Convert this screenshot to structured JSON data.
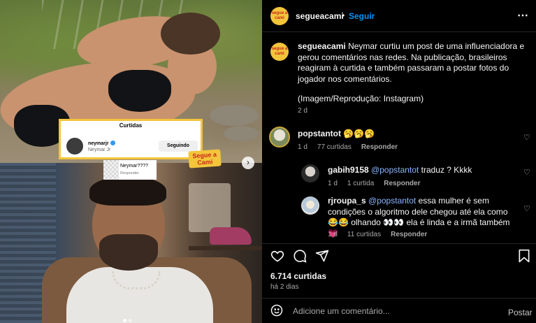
{
  "media": {
    "overlay_title": "Curtidas",
    "overlay_username": "neymarjr",
    "overlay_fullname": "Neymar Jr",
    "overlay_follow": "Seguindo",
    "reply_text": "Neymar????",
    "reply_sub": "Responder",
    "sticker": "Segue a Cami",
    "next_icon": "›"
  },
  "header": {
    "avatar_text": "segue a cami",
    "username": "segueacami",
    "dot": "•",
    "follow": "Seguir",
    "more_icon": "⋯"
  },
  "caption": {
    "avatar_text": "segue a cami",
    "username": "segueacami",
    "text": "Neymar curtiu um post de uma influenciadora e gerou comentários nas redes. Na publicação, brasileiros reagiram à curtida e também passaram a postar fotos do jogador nos comentários.",
    "credit": "(Imagem/Reprodução: Instagram)",
    "time": "2 d"
  },
  "comments": [
    {
      "username": "popstantot",
      "mention": "",
      "text": "🥱🥱🥱",
      "time": "1 d",
      "likes": "77 curtidas",
      "reply": "Responder"
    },
    {
      "username": "gabih9158",
      "mention": "@popstantot",
      "text": " traduz ? Kkkk",
      "time": "1 d",
      "likes": "1 curtida",
      "reply": "Responder"
    },
    {
      "username": "rjroupa_s",
      "mention": "@popstantot",
      "text": " essa mulher é sem condições o algoritmo dele chegou até ela como 😂😂 olhando 👀👀 ela é linda e a irmã também 💗",
      "time": "1 d",
      "likes": "11 curtidas",
      "reply": "Responder"
    }
  ],
  "actions": {
    "likes": "6.714 curtidas",
    "time": "há 2 dias"
  },
  "add_comment": {
    "placeholder": "Adicione um comentário...",
    "post": "Postar"
  },
  "colors": {
    "accent": "#0095f6",
    "brand_yellow": "#f3c53b",
    "brand_red": "#c9261b",
    "muted": "#a8a8a8"
  },
  "icons": [
    "heart-icon",
    "comment-icon",
    "share-icon",
    "bookmark-icon",
    "smiley-icon",
    "more-icon",
    "verified-icon",
    "next-icon"
  ]
}
